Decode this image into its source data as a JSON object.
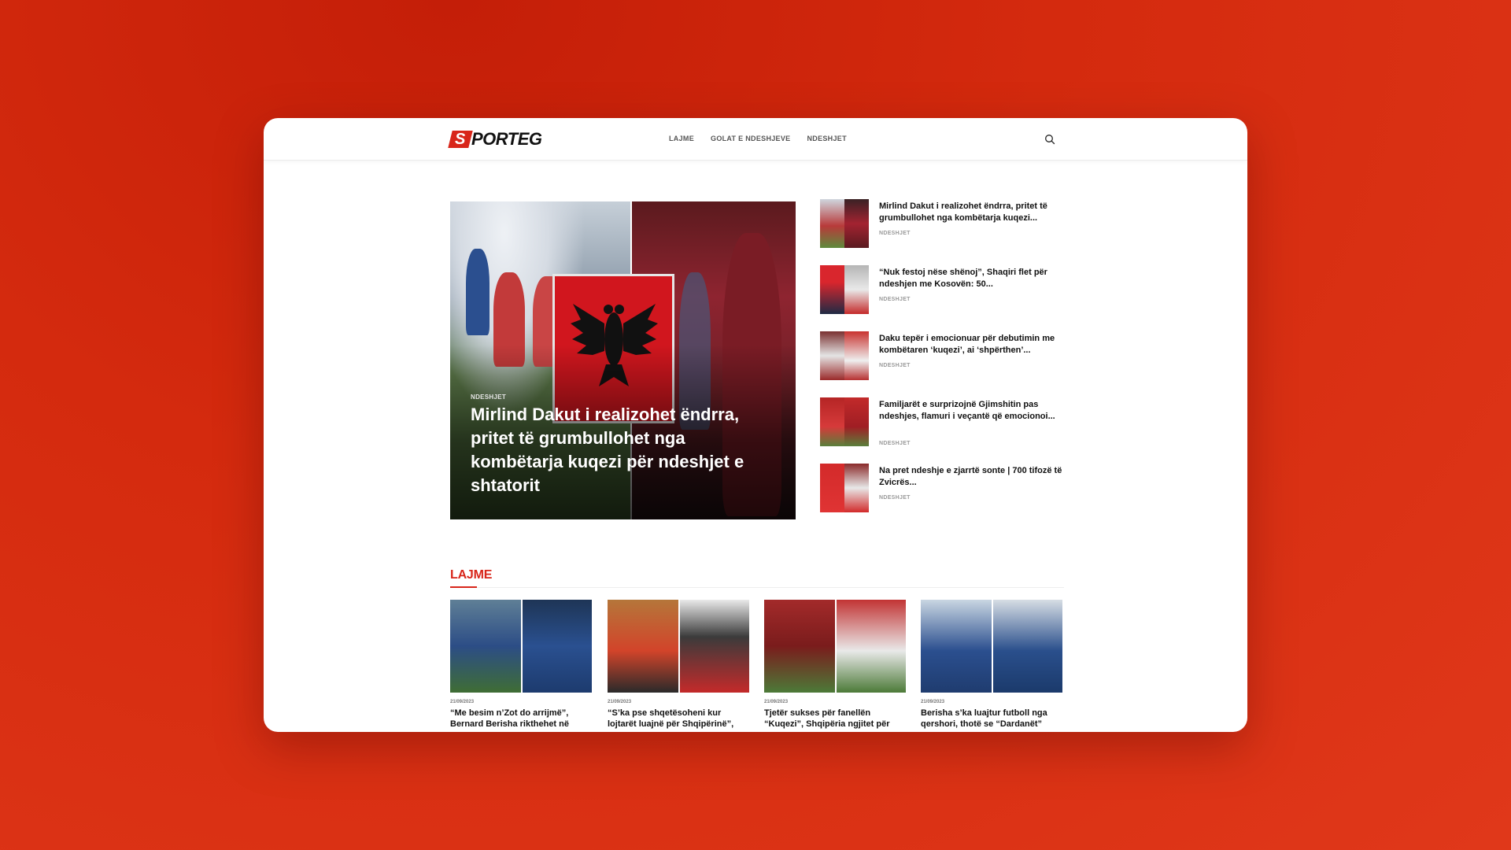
{
  "brand": {
    "logo_mark": "S",
    "logo_text": "PORTEG",
    "accent": "#d8261a"
  },
  "nav": {
    "items": [
      "LAJME",
      "GOLAT E NDESHJEVE",
      "NDESHJET"
    ]
  },
  "search": {
    "icon": "search-icon"
  },
  "hero": {
    "category": "NDESHJET",
    "title": "Mirlind Dakut i realizohet ëndrra, pritet të grumbullohet nga kombëtarja kuqezi për ndeshjet e shtatorit"
  },
  "sidebar": {
    "items": [
      {
        "title": "Mirlind Dakut i realizohet ëndrra, pritet të grumbullohet nga kombëtarja kuqezi...",
        "category": "NDESHJET"
      },
      {
        "title": "“Nuk festoj nëse shënoj”, Shaqiri flet për ndeshjen me Kosovën: 50...",
        "category": "NDESHJET"
      },
      {
        "title": "Daku tepër i emocionuar për debutimin me kombëtaren ‘kuqezi’, ai ‘shpërthen’...",
        "category": "NDESHJET"
      },
      {
        "title": "Familjarët e surprizojnë Gjimshitin pas ndeshjes, flamuri i veçantë që emocionoi...",
        "category": "NDESHJET"
      },
      {
        "title": "Na pret ndeshje e zjarrtë sonte | 700 tifozë të Zvicrës...",
        "category": "NDESHJET"
      }
    ]
  },
  "section": {
    "title": "LAJME"
  },
  "cards": [
    {
      "date": "21/09/2023",
      "title": "“Me besim n’Zot do arrijmë”, Bernard Berisha rikthehet në"
    },
    {
      "date": "21/09/2023",
      "title": "“S’ka pse shqetësoheni kur lojtarët luajnë për Shqipërinë”,"
    },
    {
      "date": "21/09/2023",
      "title": "Tjetër sukses për fanellën “Kuqezi”, Shqipëria ngjitet për"
    },
    {
      "date": "21/09/2023",
      "title": "Berisha s’ka luajtur futboll nga qershori, thotë se “Dardanët”"
    }
  ]
}
